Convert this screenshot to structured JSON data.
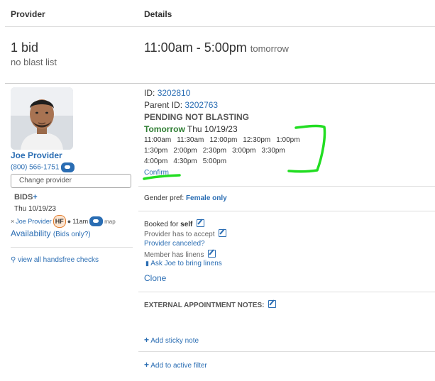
{
  "header": {
    "provider_col": "Provider",
    "details_col": "Details"
  },
  "summary": {
    "bid_count": "1 bid",
    "blast_status": "no blast list",
    "time_range": "11:00am - 5:00pm",
    "time_suffix": "tomorrow"
  },
  "provider": {
    "name": "Joe Provider",
    "phone": "(800) 566-1751",
    "change_button": "Change provider",
    "bids_title": "BIDS",
    "bids_plus": "+",
    "bids_date": "Thu 10/19/23",
    "bid_entry": {
      "remove": "×",
      "name": "Joe Provider",
      "hf_badge": "HF",
      "time": "11am",
      "map_label": "map"
    },
    "availability_label": "Availability",
    "bids_only_label": "(Bids only?)",
    "handsfree_link": "view all handsfree checks"
  },
  "details": {
    "id_label": "ID:",
    "id_value": "3202810",
    "parent_label": "Parent ID:",
    "parent_value": "3202763",
    "status": "PENDING NOT BLASTING",
    "day_highlight": "Tomorrow",
    "day_date": "Thu 10/19/23",
    "time_rows": [
      [
        "11:00am",
        "11:30am",
        "12:00pm",
        "12:30pm",
        "1:00pm"
      ],
      [
        "1:30pm",
        "2:00pm",
        "2:30pm",
        "3:00pm",
        "3:30pm"
      ],
      [
        "4:00pm",
        "4:30pm",
        "5:00pm"
      ]
    ],
    "confirm_link": "Confirm",
    "gender_label": "Gender pref:",
    "gender_value": "Female only",
    "booked_for_label": "Booked for",
    "booked_for_value": "self",
    "provider_accept": "Provider has to accept",
    "provider_canceled": "Provider canceled?",
    "member_linens": "Member has linens",
    "ask_linens": "Ask Joe to bring linens",
    "clone_link": "Clone",
    "external_notes_label": "EXTERNAL APPOINTMENT NOTES:",
    "add_sticky_note": "Add sticky note",
    "add_active_filter": "Add to active filter"
  },
  "colors": {
    "link": "#2a6db3",
    "green": "#2e7d32",
    "annotation": "#22dd22"
  }
}
